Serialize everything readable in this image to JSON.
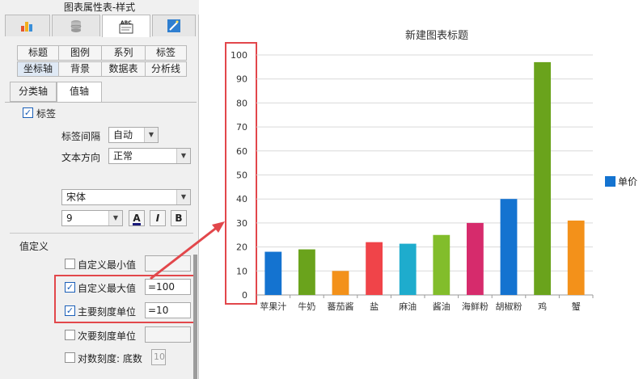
{
  "panel": {
    "title": "图表属性表-样式",
    "icon_tabs": [
      {
        "icon": "chart-type-icon",
        "active": false
      },
      {
        "icon": "database-icon",
        "active": false
      },
      {
        "icon": "abc-style-icon",
        "active": true
      },
      {
        "icon": "magic-wand-icon",
        "active": false
      }
    ],
    "subtabs_row1": [
      "标题",
      "图例",
      "系列",
      "标签"
    ],
    "subtabs_row2": [
      "坐标轴",
      "背景",
      "数据表",
      "分析线"
    ],
    "active_subtab": "坐标轴",
    "axis_tabs": [
      "分类轴",
      "值轴"
    ],
    "active_axis_tab": "值轴",
    "label_checkbox": {
      "label": "标签",
      "checked": true
    },
    "label_interval": {
      "label": "标签间隔",
      "value": "自动"
    },
    "text_direction": {
      "label": "文本方向",
      "value": "正常"
    },
    "font": {
      "family": "宋体",
      "size": "9",
      "color_btn": "A",
      "italic_btn": "I",
      "bold_btn": "B"
    },
    "value_definition": {
      "heading": "值定义",
      "custom_min": {
        "label": "自定义最小值",
        "checked": false,
        "value": ""
      },
      "custom_max": {
        "label": "自定义最大值",
        "checked": true,
        "value": "=100"
      },
      "major_unit": {
        "label": "主要刻度单位",
        "checked": true,
        "value": "=10"
      },
      "minor_unit": {
        "label": "次要刻度单位",
        "checked": false,
        "value": ""
      },
      "log_scale": {
        "label": "对数刻度: 底数",
        "checked": false,
        "value": "10"
      }
    },
    "check_mark": "✓"
  },
  "colors": {
    "highlight_red": "#e2474b",
    "series_blue": "#1473d0"
  },
  "chart_data": {
    "type": "bar",
    "title": "新建图表标题",
    "categories": [
      "苹果汁",
      "牛奶",
      "蕃茄酱",
      "盐",
      "麻油",
      "酱油",
      "海鲜粉",
      "胡椒粉",
      "鸡",
      "蟹"
    ],
    "series": [
      {
        "name": "单价",
        "values": [
          18,
          19,
          10,
          22,
          21.35,
          25,
          30,
          40,
          97,
          31
        ]
      }
    ],
    "bar_colors": [
      "#1473d0",
      "#6aa31c",
      "#f3911a",
      "#f04449",
      "#1eaccd",
      "#82bd2b",
      "#d62b6c",
      "#1473d0",
      "#6aa31c",
      "#f3911a"
    ],
    "ylim": [
      0,
      100
    ],
    "yticks": [
      "0",
      "10",
      "20",
      "30",
      "40",
      "50",
      "60",
      "70",
      "80",
      "90",
      "100"
    ],
    "xlabel": "",
    "ylabel": "",
    "grid": true,
    "legend": {
      "position": "right",
      "entries": [
        "单价"
      ]
    }
  }
}
